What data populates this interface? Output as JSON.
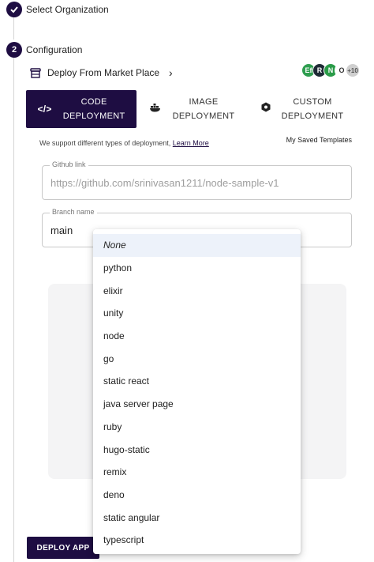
{
  "steps": [
    {
      "label": "Select Organization",
      "status": "completed"
    },
    {
      "number": "2",
      "label": "Configuration"
    }
  ],
  "market": {
    "label": "Deploy From Market Place",
    "icon": "store-icon"
  },
  "logos": [
    "Ef",
    "R",
    "N",
    "O",
    "+10"
  ],
  "colors": {
    "primary": "#1e0d42",
    "selected_option_bg": "#edf2fa"
  },
  "tabs": [
    {
      "line1": "CODE",
      "line2": "DEPLOYMENT",
      "icon": "code-icon",
      "active": true
    },
    {
      "line1": "IMAGE",
      "line2": "DEPLOYMENT",
      "icon": "docker-icon",
      "active": false
    },
    {
      "line1": "CUSTOM",
      "line2": "DEPLOYMENT",
      "icon": "hexagon-icon",
      "active": false
    }
  ],
  "support": {
    "text": "We support different types of deployment,",
    "link": "Learn More"
  },
  "saved_templates": "My Saved Templates",
  "github": {
    "label": "Github link",
    "value": "https://github.com/srinivasan1211/node-sample-v1"
  },
  "branch": {
    "label": "Branch name",
    "value": "main"
  },
  "dropdown_options": [
    "None",
    "python",
    "elixir",
    "unity",
    "node",
    "go",
    "static react",
    "java server page",
    "ruby",
    "hugo-static",
    "remix",
    "deno",
    "static angular",
    "typescript"
  ],
  "deploy_button": "DEPLOY APP"
}
